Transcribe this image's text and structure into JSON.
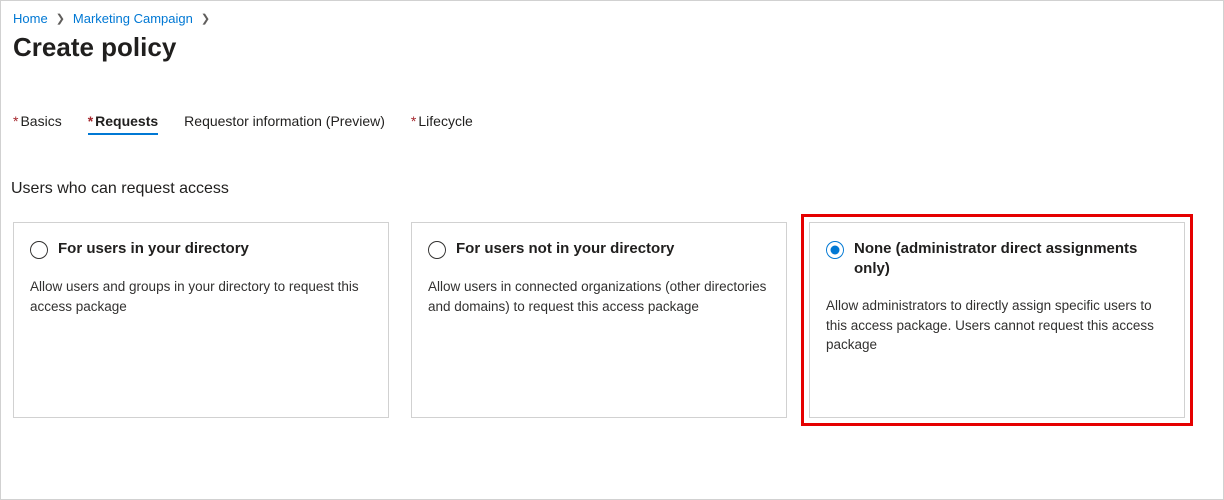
{
  "breadcrumb": {
    "items": [
      {
        "label": "Home"
      },
      {
        "label": "Marketing Campaign"
      }
    ]
  },
  "page_title": "Create policy",
  "tabs": [
    {
      "label": "Basics",
      "required": true,
      "active": false
    },
    {
      "label": "Requests",
      "required": true,
      "active": true
    },
    {
      "label": "Requestor information (Preview)",
      "required": false,
      "active": false
    },
    {
      "label": "Lifecycle",
      "required": true,
      "active": false
    }
  ],
  "section": {
    "title": "Users who can request access"
  },
  "cards": [
    {
      "title": "For users in your directory",
      "description": "Allow users and groups in your directory to request this access package",
      "selected": false,
      "highlighted": false
    },
    {
      "title": "For users not in your directory",
      "description": "Allow users in connected organizations (other directories and domains) to request this access package",
      "selected": false,
      "highlighted": false
    },
    {
      "title": "None (administrator direct assignments only)",
      "description": "Allow administrators to directly assign specific users to this access package. Users cannot request this access package",
      "selected": true,
      "highlighted": true
    }
  ]
}
